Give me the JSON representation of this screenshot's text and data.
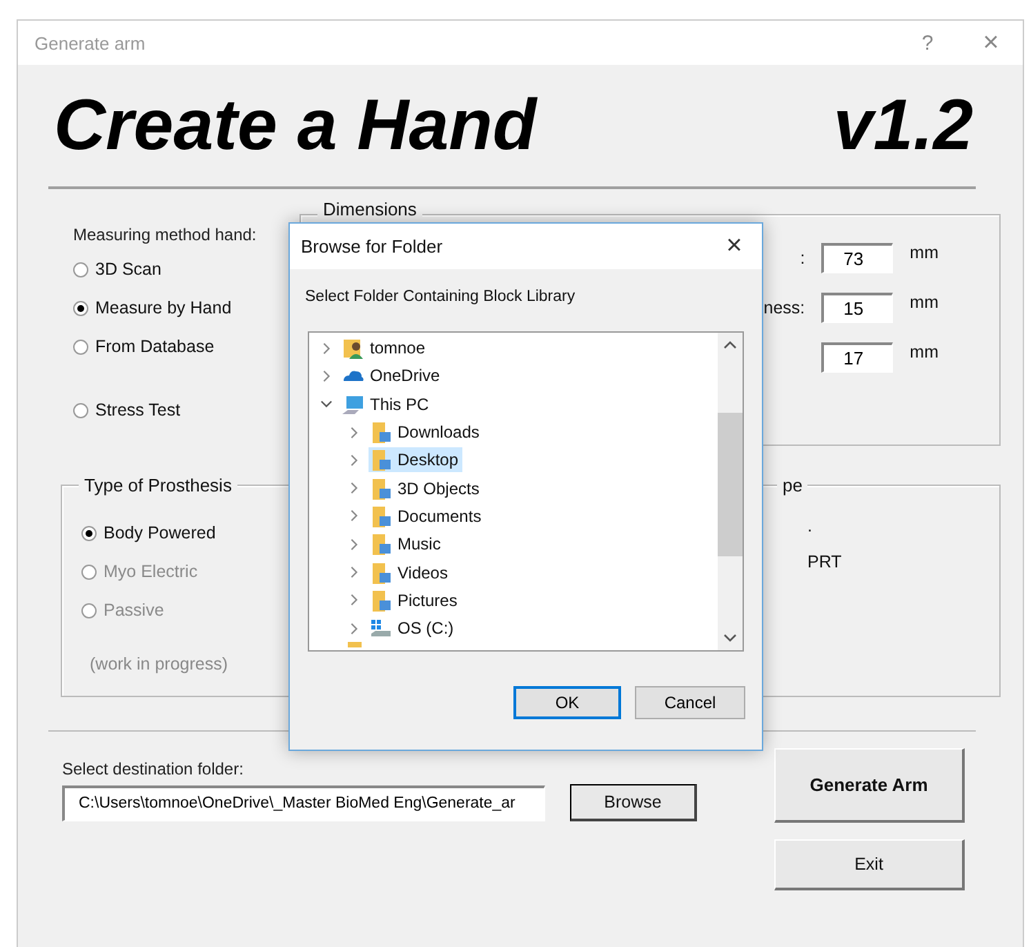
{
  "window": {
    "title": "Generate arm",
    "help": "?",
    "close": "×"
  },
  "heading": {
    "title": "Create a Hand",
    "version": "v1.2"
  },
  "measuring": {
    "label": "Measuring method hand:",
    "options": [
      {
        "label": "3D Scan",
        "selected": false
      },
      {
        "label": "Measure by Hand",
        "selected": true
      },
      {
        "label": "From Database",
        "selected": false
      },
      {
        "label": "Stress Test",
        "selected": false
      }
    ]
  },
  "dimensions": {
    "title": "Dimensions",
    "fields": [
      {
        "label": ":",
        "value": "73",
        "unit": "mm"
      },
      {
        "label": "ness:",
        "value": "15",
        "unit": "mm"
      },
      {
        "value": "17",
        "unit": "mm"
      }
    ]
  },
  "prosthesis": {
    "title": "Type of Prosthesis",
    "options": [
      {
        "label": "Body Powered",
        "selected": true,
        "disabled": false
      },
      {
        "label": "Myo Electric",
        "selected": false,
        "disabled": true
      },
      {
        "label": "Passive",
        "selected": false,
        "disabled": true
      }
    ],
    "note": "(work in progress)"
  },
  "right_group": {
    "title": "pe",
    "lines": [
      ".",
      "PRT"
    ]
  },
  "destination": {
    "label": "Select destination folder:",
    "value": "C:\\Users\\tomnoe\\OneDrive\\_Master BioMed Eng\\Generate_ar",
    "browse": "Browse"
  },
  "buttons": {
    "generate": "Generate Arm",
    "exit": "Exit"
  },
  "dialog": {
    "title": "Browse for Folder",
    "close": "×",
    "prompt": "Select Folder Containing Block Library",
    "ok": "OK",
    "cancel": "Cancel",
    "tree": [
      {
        "label": "tomnoe",
        "expanded": false,
        "selected": false
      },
      {
        "label": "OneDrive",
        "expanded": false,
        "selected": false
      },
      {
        "label": "This PC",
        "expanded": true,
        "selected": false,
        "children": [
          {
            "label": "Downloads",
            "expanded": false,
            "selected": false
          },
          {
            "label": "Desktop",
            "expanded": false,
            "selected": true
          },
          {
            "label": "3D Objects",
            "expanded": false,
            "selected": false
          },
          {
            "label": "Documents",
            "expanded": false,
            "selected": false
          },
          {
            "label": "Music",
            "expanded": false,
            "selected": false
          },
          {
            "label": "Videos",
            "expanded": false,
            "selected": false
          },
          {
            "label": "Pictures",
            "expanded": false,
            "selected": false
          },
          {
            "label": "OS (C:)",
            "expanded": false,
            "selected": false
          }
        ]
      }
    ]
  }
}
